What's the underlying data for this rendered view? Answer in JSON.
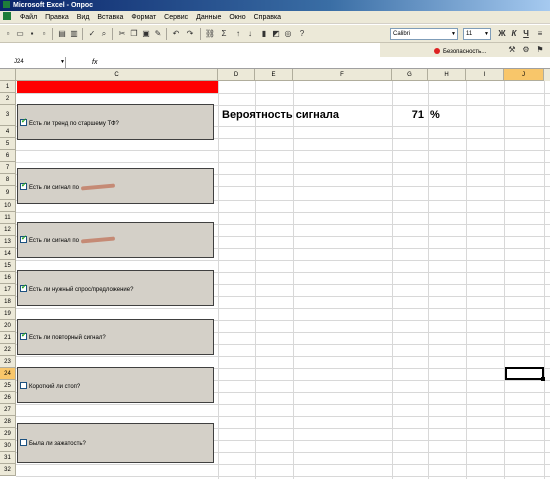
{
  "window": {
    "title": "Microsoft Excel - Опрос"
  },
  "menu": [
    "Файл",
    "Правка",
    "Вид",
    "Вставка",
    "Формат",
    "Сервис",
    "Данные",
    "Окно",
    "Справка"
  ],
  "toolbar": {
    "font_name": "Calibri",
    "font_size": "11",
    "bold": "Ж",
    "italic": "К",
    "underline": "Ч",
    "security_label": "Безопасность..."
  },
  "formula_bar": {
    "name_box": "J24",
    "fx": "fx",
    "content": ""
  },
  "columns": [
    "C",
    "D",
    "E",
    "F",
    "G",
    "H",
    "I",
    "J"
  ],
  "active_column": "J",
  "active_row": "24",
  "rows": [
    "1",
    "2",
    "3",
    "4",
    "5",
    "6",
    "7",
    "8",
    "9",
    "10",
    "11",
    "12",
    "13",
    "14",
    "15",
    "16",
    "17",
    "18",
    "19",
    "20",
    "21",
    "22",
    "23",
    "24",
    "25",
    "26",
    "27",
    "28",
    "29",
    "30",
    "31",
    "32"
  ],
  "questions": [
    {
      "text": "Есть ли тренд по старшему ТФ?",
      "checked": true
    },
    {
      "text": "Есть ли сигнал по",
      "checked": true,
      "redacted": true
    },
    {
      "text": "Есть ли сигнал по",
      "checked": true,
      "redacted": true
    },
    {
      "text": "Есть ли нужный спрос/предложение?",
      "checked": true
    },
    {
      "text": "Есть ли повторный сигнал?",
      "checked": true
    },
    {
      "text": "Короткий ли стоп?",
      "checked": false
    },
    {
      "text": "Была ли зажатость?",
      "checked": false
    }
  ],
  "probability": {
    "label": "Вероятность сигнала",
    "value": "71",
    "unit": "%"
  },
  "colors": {
    "red_bar": "#ff0000",
    "panel": "#d4d0c8",
    "check": "#21a121"
  }
}
